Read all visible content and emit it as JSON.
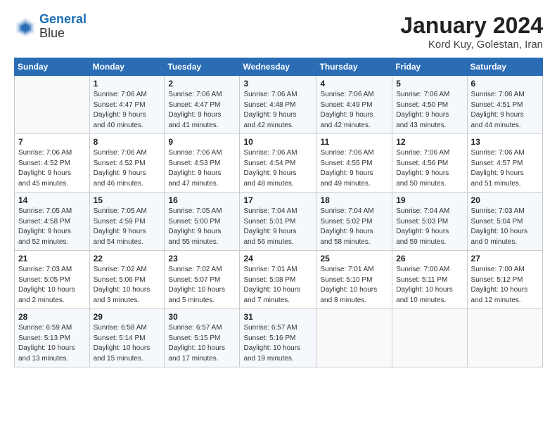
{
  "header": {
    "logo_line1": "General",
    "logo_line2": "Blue",
    "title": "January 2024",
    "subtitle": "Kord Kuy, Golestan, Iran"
  },
  "weekdays": [
    "Sunday",
    "Monday",
    "Tuesday",
    "Wednesday",
    "Thursday",
    "Friday",
    "Saturday"
  ],
  "weeks": [
    [
      {
        "day": "",
        "info": ""
      },
      {
        "day": "1",
        "info": "Sunrise: 7:06 AM\nSunset: 4:47 PM\nDaylight: 9 hours\nand 40 minutes."
      },
      {
        "day": "2",
        "info": "Sunrise: 7:06 AM\nSunset: 4:47 PM\nDaylight: 9 hours\nand 41 minutes."
      },
      {
        "day": "3",
        "info": "Sunrise: 7:06 AM\nSunset: 4:48 PM\nDaylight: 9 hours\nand 42 minutes."
      },
      {
        "day": "4",
        "info": "Sunrise: 7:06 AM\nSunset: 4:49 PM\nDaylight: 9 hours\nand 42 minutes."
      },
      {
        "day": "5",
        "info": "Sunrise: 7:06 AM\nSunset: 4:50 PM\nDaylight: 9 hours\nand 43 minutes."
      },
      {
        "day": "6",
        "info": "Sunrise: 7:06 AM\nSunset: 4:51 PM\nDaylight: 9 hours\nand 44 minutes."
      }
    ],
    [
      {
        "day": "7",
        "info": "Sunrise: 7:06 AM\nSunset: 4:52 PM\nDaylight: 9 hours\nand 45 minutes."
      },
      {
        "day": "8",
        "info": "Sunrise: 7:06 AM\nSunset: 4:52 PM\nDaylight: 9 hours\nand 46 minutes."
      },
      {
        "day": "9",
        "info": "Sunrise: 7:06 AM\nSunset: 4:53 PM\nDaylight: 9 hours\nand 47 minutes."
      },
      {
        "day": "10",
        "info": "Sunrise: 7:06 AM\nSunset: 4:54 PM\nDaylight: 9 hours\nand 48 minutes."
      },
      {
        "day": "11",
        "info": "Sunrise: 7:06 AM\nSunset: 4:55 PM\nDaylight: 9 hours\nand 49 minutes."
      },
      {
        "day": "12",
        "info": "Sunrise: 7:06 AM\nSunset: 4:56 PM\nDaylight: 9 hours\nand 50 minutes."
      },
      {
        "day": "13",
        "info": "Sunrise: 7:06 AM\nSunset: 4:57 PM\nDaylight: 9 hours\nand 51 minutes."
      }
    ],
    [
      {
        "day": "14",
        "info": "Sunrise: 7:05 AM\nSunset: 4:58 PM\nDaylight: 9 hours\nand 52 minutes."
      },
      {
        "day": "15",
        "info": "Sunrise: 7:05 AM\nSunset: 4:59 PM\nDaylight: 9 hours\nand 54 minutes."
      },
      {
        "day": "16",
        "info": "Sunrise: 7:05 AM\nSunset: 5:00 PM\nDaylight: 9 hours\nand 55 minutes."
      },
      {
        "day": "17",
        "info": "Sunrise: 7:04 AM\nSunset: 5:01 PM\nDaylight: 9 hours\nand 56 minutes."
      },
      {
        "day": "18",
        "info": "Sunrise: 7:04 AM\nSunset: 5:02 PM\nDaylight: 9 hours\nand 58 minutes."
      },
      {
        "day": "19",
        "info": "Sunrise: 7:04 AM\nSunset: 5:03 PM\nDaylight: 9 hours\nand 59 minutes."
      },
      {
        "day": "20",
        "info": "Sunrise: 7:03 AM\nSunset: 5:04 PM\nDaylight: 10 hours\nand 0 minutes."
      }
    ],
    [
      {
        "day": "21",
        "info": "Sunrise: 7:03 AM\nSunset: 5:05 PM\nDaylight: 10 hours\nand 2 minutes."
      },
      {
        "day": "22",
        "info": "Sunrise: 7:02 AM\nSunset: 5:06 PM\nDaylight: 10 hours\nand 3 minutes."
      },
      {
        "day": "23",
        "info": "Sunrise: 7:02 AM\nSunset: 5:07 PM\nDaylight: 10 hours\nand 5 minutes."
      },
      {
        "day": "24",
        "info": "Sunrise: 7:01 AM\nSunset: 5:08 PM\nDaylight: 10 hours\nand 7 minutes."
      },
      {
        "day": "25",
        "info": "Sunrise: 7:01 AM\nSunset: 5:10 PM\nDaylight: 10 hours\nand 8 minutes."
      },
      {
        "day": "26",
        "info": "Sunrise: 7:00 AM\nSunset: 5:11 PM\nDaylight: 10 hours\nand 10 minutes."
      },
      {
        "day": "27",
        "info": "Sunrise: 7:00 AM\nSunset: 5:12 PM\nDaylight: 10 hours\nand 12 minutes."
      }
    ],
    [
      {
        "day": "28",
        "info": "Sunrise: 6:59 AM\nSunset: 5:13 PM\nDaylight: 10 hours\nand 13 minutes."
      },
      {
        "day": "29",
        "info": "Sunrise: 6:58 AM\nSunset: 5:14 PM\nDaylight: 10 hours\nand 15 minutes."
      },
      {
        "day": "30",
        "info": "Sunrise: 6:57 AM\nSunset: 5:15 PM\nDaylight: 10 hours\nand 17 minutes."
      },
      {
        "day": "31",
        "info": "Sunrise: 6:57 AM\nSunset: 5:16 PM\nDaylight: 10 hours\nand 19 minutes."
      },
      {
        "day": "",
        "info": ""
      },
      {
        "day": "",
        "info": ""
      },
      {
        "day": "",
        "info": ""
      }
    ]
  ]
}
